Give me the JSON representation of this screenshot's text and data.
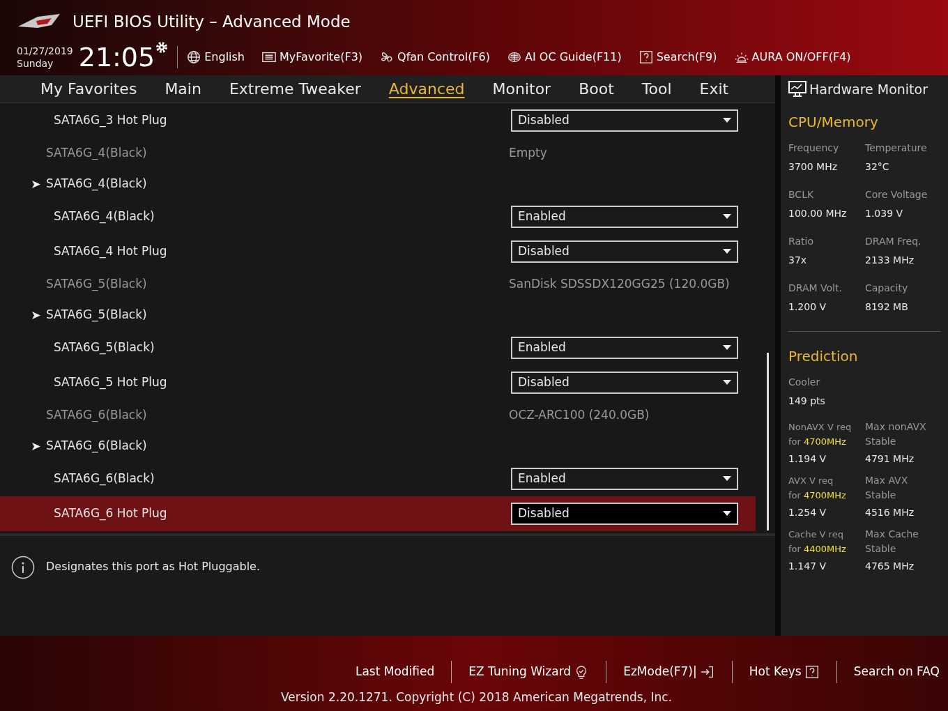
{
  "header": {
    "title": "UEFI BIOS Utility – Advanced Mode",
    "date": "01/27/2019",
    "day": "Sunday",
    "time": "21:05",
    "tools": [
      {
        "kind": "globe",
        "label": "English"
      },
      {
        "kind": "list",
        "label": "MyFavorite(F3)"
      },
      {
        "kind": "fan",
        "label": "Qfan Control(F6)"
      },
      {
        "kind": "chip",
        "label": "AI OC Guide(F11)"
      },
      {
        "kind": "help",
        "label": "Search(F9)"
      },
      {
        "kind": "light",
        "label": "AURA ON/OFF(F4)"
      }
    ]
  },
  "tabs": [
    {
      "label": "My Favorites",
      "selected": false
    },
    {
      "label": "Main",
      "selected": false
    },
    {
      "label": "Extreme Tweaker",
      "selected": false
    },
    {
      "label": "Advanced",
      "selected": true
    },
    {
      "label": "Monitor",
      "selected": false
    },
    {
      "label": "Boot",
      "selected": false
    },
    {
      "label": "Tool",
      "selected": false
    },
    {
      "label": "Exit",
      "selected": false
    }
  ],
  "settings": [
    {
      "kind": "option",
      "label": "SATA6G_3 Hot Plug",
      "value": "Disabled",
      "selected": false
    },
    {
      "kind": "info",
      "label": "SATA6G_4(Black)",
      "value": "Empty"
    },
    {
      "kind": "group",
      "label": "SATA6G_4(Black)"
    },
    {
      "kind": "option",
      "label": "SATA6G_4(Black)",
      "value": "Enabled",
      "selected": false
    },
    {
      "kind": "option",
      "label": "SATA6G_4 Hot Plug",
      "value": "Disabled",
      "selected": false
    },
    {
      "kind": "info",
      "label": "SATA6G_5(Black)",
      "value": "SanDisk SDSSDX120GG25 (120.0GB)"
    },
    {
      "kind": "group",
      "label": "SATA6G_5(Black)"
    },
    {
      "kind": "option",
      "label": "SATA6G_5(Black)",
      "value": "Enabled",
      "selected": false
    },
    {
      "kind": "option",
      "label": "SATA6G_5 Hot Plug",
      "value": "Disabled",
      "selected": false
    },
    {
      "kind": "info",
      "label": "SATA6G_6(Black)",
      "value": "OCZ-ARC100 (240.0GB)"
    },
    {
      "kind": "group",
      "label": "SATA6G_6(Black)"
    },
    {
      "kind": "option",
      "label": "SATA6G_6(Black)",
      "value": "Enabled",
      "selected": false
    },
    {
      "kind": "option",
      "label": "SATA6G_6 Hot Plug",
      "value": "Disabled",
      "selected": true
    }
  ],
  "help_text": "Designates this port as Hot Pluggable.",
  "hardware_monitor": {
    "title": "Hardware Monitor",
    "cpu_memory": {
      "title": "CPU/Memory",
      "items": [
        {
          "label": "Frequency",
          "value": "3700 MHz"
        },
        {
          "label": "Temperature",
          "value": "32°C"
        },
        {
          "label": "BCLK",
          "value": "100.00 MHz"
        },
        {
          "label": "Core Voltage",
          "value": "1.039 V"
        },
        {
          "label": "Ratio",
          "value": "37x"
        },
        {
          "label": "DRAM Freq.",
          "value": "2133 MHz"
        },
        {
          "label": "DRAM Volt.",
          "value": "1.200 V"
        },
        {
          "label": "Capacity",
          "value": "8192 MB"
        }
      ]
    },
    "prediction": {
      "title": "Prediction",
      "cooler_label": "Cooler",
      "cooler_value": "149 pts",
      "items": [
        {
          "label": "NonAVX V req",
          "for": "for",
          "freq": "4700MHz",
          "value": "1.194 V",
          "max_label": "Max nonAVX",
          "max_sub": "Stable",
          "max_value": "4791 MHz"
        },
        {
          "label": "AVX V req",
          "for": "for",
          "freq": "4700MHz",
          "value": "1.254 V",
          "max_label": "Max AVX",
          "max_sub": "Stable",
          "max_value": "4516 MHz"
        },
        {
          "label": "Cache V req",
          "for": "for",
          "freq": "4400MHz",
          "value": "1.147 V",
          "max_label": "Max Cache",
          "max_sub": "Stable",
          "max_value": "4765 MHz"
        }
      ]
    }
  },
  "footer": {
    "links": [
      {
        "kind": "plain",
        "label": "Last Modified"
      },
      {
        "kind": "bulb",
        "label": "EZ Tuning Wizard"
      },
      {
        "kind": "exit",
        "label": "EzMode(F7)|"
      },
      {
        "kind": "help",
        "label": "Hot Keys"
      },
      {
        "kind": "plain",
        "label": "Search on FAQ"
      }
    ],
    "version": "Version 2.20.1271. Copyright (C) 2018 American Megatrends, Inc."
  }
}
